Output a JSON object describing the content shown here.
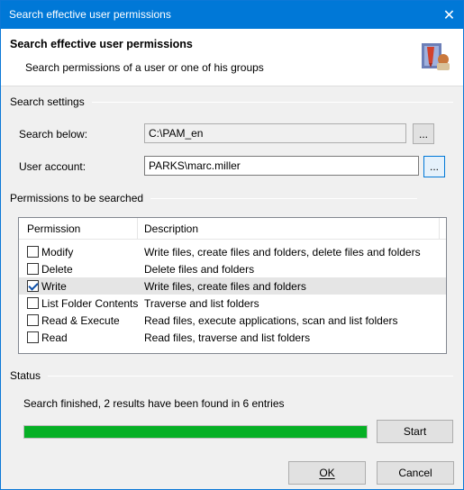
{
  "window": {
    "title": "Search effective user permissions",
    "close_glyph": "✕"
  },
  "banner": {
    "heading": "Search effective user permissions",
    "subheading": "Search permissions of a user or one of his groups",
    "logo_icon": "permissions-logo-icon"
  },
  "search_settings": {
    "section_label": "Search settings",
    "search_below_label": "Search below:",
    "search_below_value": "C:\\PAM_en",
    "user_account_label": "User account:",
    "user_account_value": "PARKS\\marc.miller",
    "browse_label": "..."
  },
  "permissions": {
    "section_label": "Permissions to be searched",
    "columns": [
      "Permission",
      "Description"
    ],
    "rows": [
      {
        "name": "Modify",
        "description": "Write files, create files and folders, delete files and folders",
        "checked": false
      },
      {
        "name": "Delete",
        "description": "Delete files and folders",
        "checked": false
      },
      {
        "name": "Write",
        "description": "Write files, create files and folders",
        "checked": true
      },
      {
        "name": "List Folder Contents",
        "description": "Traverse and list folders",
        "checked": false
      },
      {
        "name": "Read & Execute",
        "description": "Read files, execute applications, scan and list folders",
        "checked": false
      },
      {
        "name": "Read",
        "description": "Read files, traverse and list folders",
        "checked": false
      }
    ]
  },
  "status": {
    "section_label": "Status",
    "message": "Search finished, 2 results have been found in 6 entries",
    "progress": 1.0,
    "progress_color": "#06b025",
    "start_label": "Start"
  },
  "footer": {
    "ok_label": "OK",
    "cancel_label": "Cancel"
  },
  "colors": {
    "titlebar": "#0078d7",
    "accent": "#0078d7"
  }
}
